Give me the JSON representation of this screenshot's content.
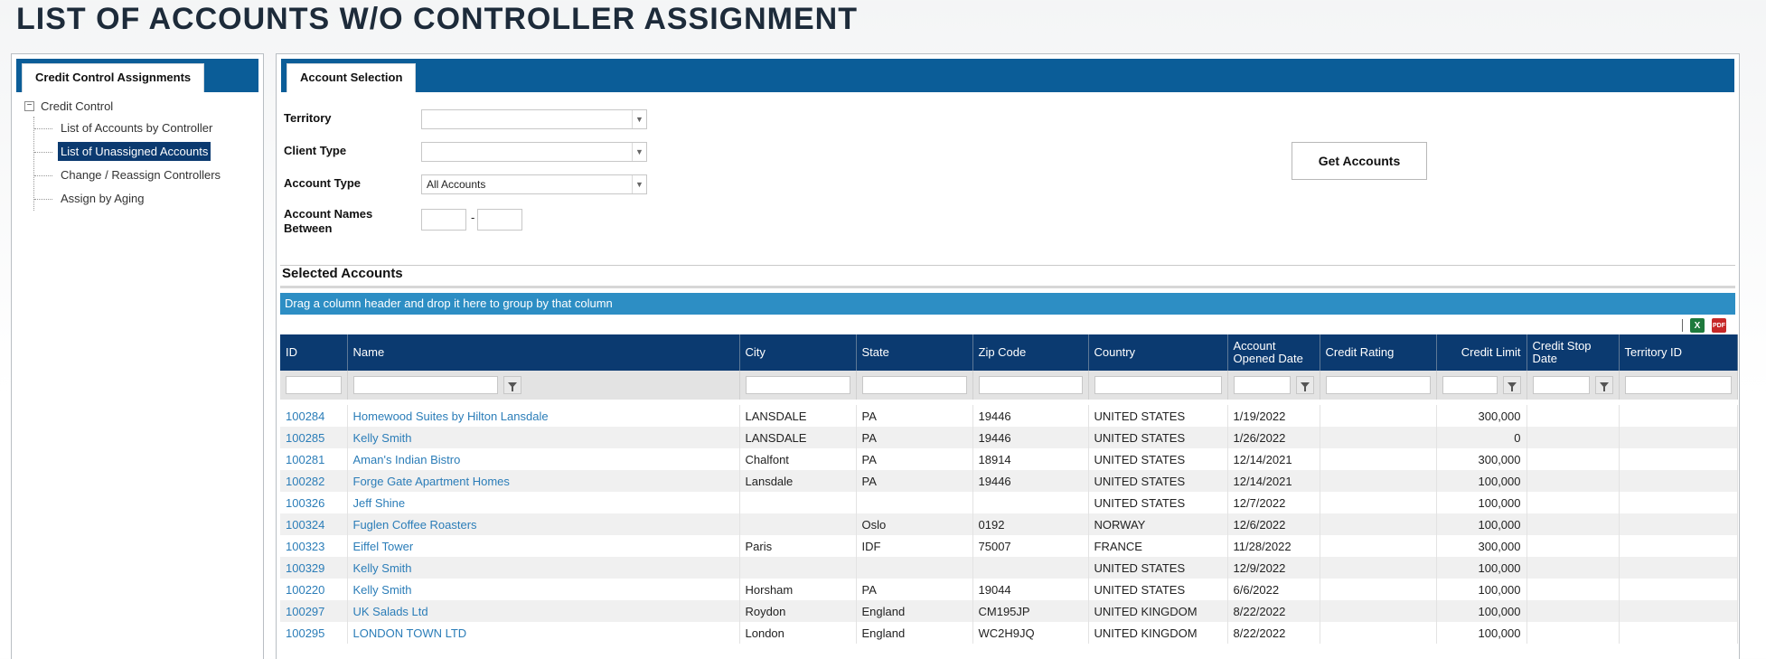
{
  "page_title": "LIST OF ACCOUNTS W/O CONTROLLER ASSIGNMENT",
  "left_panel": {
    "tab_label": "Credit Control Assignments",
    "tree": {
      "root_label": "Credit Control",
      "toggle_symbol": "−",
      "items": [
        {
          "label": "List of Accounts by Controller",
          "selected": false
        },
        {
          "label": "List of Unassigned Accounts",
          "selected": true
        },
        {
          "label": "Change / Reassign Controllers",
          "selected": false
        },
        {
          "label": "Assign by Aging",
          "selected": false
        }
      ]
    }
  },
  "right_panel": {
    "tab_label": "Account Selection",
    "form": {
      "territory_label": "Territory",
      "territory_value": "",
      "client_type_label": "Client Type",
      "client_type_value": "",
      "account_type_label": "Account Type",
      "account_type_value": "All Accounts",
      "account_names_label_line1": "Account Names",
      "account_names_label_line2": "Between",
      "range_from": "",
      "range_to": "",
      "range_separator": "-",
      "get_accounts_button": "Get Accounts"
    },
    "selected_accounts_title": "Selected Accounts",
    "group_bar_text": "Drag a column header and drop it here to group by that column",
    "export_icons": [
      "excel-icon",
      "pdf-icon"
    ],
    "grid": {
      "columns": [
        {
          "key": "id",
          "label": "ID"
        },
        {
          "key": "name",
          "label": "Name"
        },
        {
          "key": "city",
          "label": "City"
        },
        {
          "key": "state",
          "label": "State"
        },
        {
          "key": "zip",
          "label": "Zip Code"
        },
        {
          "key": "country",
          "label": "Country"
        },
        {
          "key": "opened",
          "label": "Account Opened Date"
        },
        {
          "key": "rating",
          "label": "Credit Rating"
        },
        {
          "key": "limit",
          "label": "Credit Limit"
        },
        {
          "key": "stop",
          "label": "Credit Stop Date"
        },
        {
          "key": "territory",
          "label": "Territory ID"
        }
      ],
      "rows": [
        {
          "id": "100284",
          "name": "Homewood Suites by Hilton Lansdale",
          "city": "LANSDALE",
          "state": "PA",
          "zip": "19446",
          "country": "UNITED STATES",
          "opened": "1/19/2022",
          "rating": "",
          "limit": "300,000",
          "stop": "",
          "territory": ""
        },
        {
          "id": "100285",
          "name": "Kelly Smith",
          "city": "LANSDALE",
          "state": "PA",
          "zip": "19446",
          "country": "UNITED STATES",
          "opened": "1/26/2022",
          "rating": "",
          "limit": "0",
          "stop": "",
          "territory": ""
        },
        {
          "id": "100281",
          "name": "Aman's Indian Bistro",
          "city": "Chalfont",
          "state": "PA",
          "zip": "18914",
          "country": "UNITED STATES",
          "opened": "12/14/2021",
          "rating": "",
          "limit": "300,000",
          "stop": "",
          "territory": ""
        },
        {
          "id": "100282",
          "name": "Forge Gate Apartment Homes",
          "city": "Lansdale",
          "state": "PA",
          "zip": "19446",
          "country": "UNITED STATES",
          "opened": "12/14/2021",
          "rating": "",
          "limit": "100,000",
          "stop": "",
          "territory": ""
        },
        {
          "id": "100326",
          "name": "Jeff Shine",
          "city": "",
          "state": "",
          "zip": "",
          "country": "UNITED STATES",
          "opened": "12/7/2022",
          "rating": "",
          "limit": "100,000",
          "stop": "",
          "territory": ""
        },
        {
          "id": "100324",
          "name": "Fuglen Coffee Roasters",
          "city": "",
          "state": "Oslo",
          "zip": "0192",
          "country": "NORWAY",
          "opened": "12/6/2022",
          "rating": "",
          "limit": "100,000",
          "stop": "",
          "territory": ""
        },
        {
          "id": "100323",
          "name": "Eiffel Tower",
          "city": "Paris",
          "state": "IDF",
          "zip": "75007",
          "country": "FRANCE",
          "opened": "11/28/2022",
          "rating": "",
          "limit": "300,000",
          "stop": "",
          "territory": ""
        },
        {
          "id": "100329",
          "name": "Kelly Smith",
          "city": "",
          "state": "",
          "zip": "",
          "country": "UNITED STATES",
          "opened": "12/9/2022",
          "rating": "",
          "limit": "100,000",
          "stop": "",
          "territory": ""
        },
        {
          "id": "100220",
          "name": "Kelly Smith",
          "city": "Horsham",
          "state": "PA",
          "zip": "19044",
          "country": "UNITED STATES",
          "opened": "6/6/2022",
          "rating": "",
          "limit": "100,000",
          "stop": "",
          "territory": ""
        },
        {
          "id": "100297",
          "name": "UK Salads Ltd",
          "city": "Roydon",
          "state": "England",
          "zip": "CM195JP",
          "country": "UNITED KINGDOM",
          "opened": "8/22/2022",
          "rating": "",
          "limit": "100,000",
          "stop": "",
          "territory": ""
        },
        {
          "id": "100295",
          "name": "LONDON TOWN LTD",
          "city": "London",
          "state": "England",
          "zip": "WC2H9JQ",
          "country": "UNITED KINGDOM",
          "opened": "8/22/2022",
          "rating": "",
          "limit": "100,000",
          "stop": "",
          "territory": ""
        }
      ]
    }
  }
}
